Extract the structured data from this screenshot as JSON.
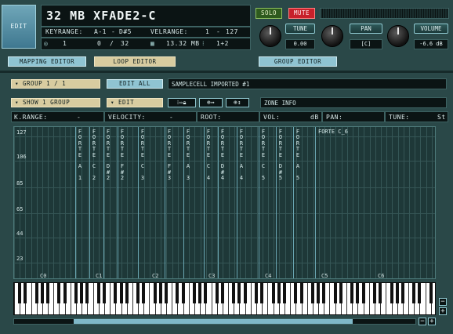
{
  "header": {
    "edit_label": "EDIT",
    "title": "32 MB XFADE2-C",
    "solo_label": "SOLO",
    "mute_label": "MUTE",
    "keyrange_label": "KEYRANGE:",
    "keyrange_lo": "A-1",
    "keyrange_sep": "-",
    "keyrange_hi": "D#5",
    "velrange_label": "VELRANGE:",
    "velrange_lo": "1",
    "velrange_sep": "-",
    "velrange_hi": "127",
    "count": "1",
    "zones": "0",
    "zones_sep": "/",
    "zones_total": "32",
    "memory": "13.32 MB",
    "voices": "1+2",
    "tune_label": "TUNE",
    "tune_value": "0.00",
    "pan_label": "PAN",
    "pan_value": "[C]",
    "volume_label": "VOLUME",
    "volume_value": "-6.6 dB"
  },
  "toolbar": {
    "mapping_editor": "MAPPING EDITOR",
    "loop_editor": "LOOP EDITOR",
    "group_editor": "GROUP EDITOR"
  },
  "group_bar": {
    "group_select": "GROUP 1 / 1",
    "edit_all": "EDIT ALL",
    "group_name": "SAMPLECELL IMPORTED #1"
  },
  "zone_bar": {
    "show_group": "SHOW 1 GROUP",
    "edit": "EDIT",
    "zone_info": "ZONE INFO"
  },
  "info_bar": {
    "krange_label": "K.RANGE:",
    "krange_value": "-",
    "velocity_label": "VELOCITY:",
    "velocity_value": "-",
    "root_label": "ROOT:",
    "vol_label": "VOL:",
    "vol_unit": "dB",
    "pan_label": "PAN:",
    "tune_label": "TUNE:",
    "tune_unit": "St"
  },
  "velocity_ticks": [
    "127",
    "106",
    "85",
    "65",
    "44",
    "23"
  ],
  "octave_labels": [
    "C0",
    "C1",
    "C2",
    "C3",
    "C4",
    "C5",
    "C6"
  ],
  "zones": [
    {
      "name": "FORTE A1"
    },
    {
      "name": "FORTE C2"
    },
    {
      "name": "FORTE D#2"
    },
    {
      "name": "FORTE F#2"
    },
    {
      "name": "FORTE C3"
    },
    {
      "name": "FORTE F#3"
    },
    {
      "name": "FORTE A3"
    },
    {
      "name": "FORTE C4"
    },
    {
      "name": "FORTE D#4"
    },
    {
      "name": "FORTE A4"
    },
    {
      "name": "FORTE C5"
    },
    {
      "name": "FORTE D#5"
    },
    {
      "name": "FORTE A5"
    },
    {
      "name": "FORTE C_6"
    }
  ],
  "zone_labels_vertical": [
    [
      "F",
      "O",
      "R",
      "T",
      "E",
      "",
      "A",
      "",
      "1"
    ],
    [
      "F",
      "O",
      "R",
      "T",
      "E",
      "",
      "C",
      "",
      "2"
    ],
    [
      "F",
      "O",
      "R",
      "T",
      "E",
      "",
      "D",
      "#",
      "2"
    ],
    [
      "F",
      "O",
      "R",
      "T",
      "E",
      "",
      "F",
      "#",
      "2"
    ],
    [
      "F",
      "O",
      "R",
      "T",
      "E",
      "",
      "C",
      "",
      "3"
    ],
    [
      "F",
      "O",
      "R",
      "T",
      "E",
      "",
      "F",
      "#",
      "3"
    ],
    [
      "F",
      "O",
      "R",
      "T",
      "E",
      "",
      "A",
      "",
      "3"
    ],
    [
      "F",
      "O",
      "R",
      "T",
      "E",
      "",
      "C",
      "",
      "4"
    ],
    [
      "F",
      "O",
      "R",
      "T",
      "E",
      "",
      "D",
      "#",
      "4"
    ],
    [
      "F",
      "O",
      "R",
      "T",
      "E",
      "",
      "A",
      "",
      "4"
    ],
    [
      "F",
      "O",
      "R",
      "T",
      "E",
      "",
      "C",
      "",
      "5"
    ],
    [
      "F",
      "O",
      "R",
      "T",
      "E",
      "",
      "D",
      "#",
      "5"
    ],
    [
      "F",
      "O",
      "R",
      "T",
      "E",
      "",
      "A",
      "",
      "5"
    ]
  ],
  "last_zone_label": "FORTE C_6",
  "scroll": {
    "minus": "−",
    "plus": "+"
  },
  "colors": {
    "accent": "#7fb8c8",
    "mute": "#c8202a",
    "solo": "#2e5a1e"
  }
}
